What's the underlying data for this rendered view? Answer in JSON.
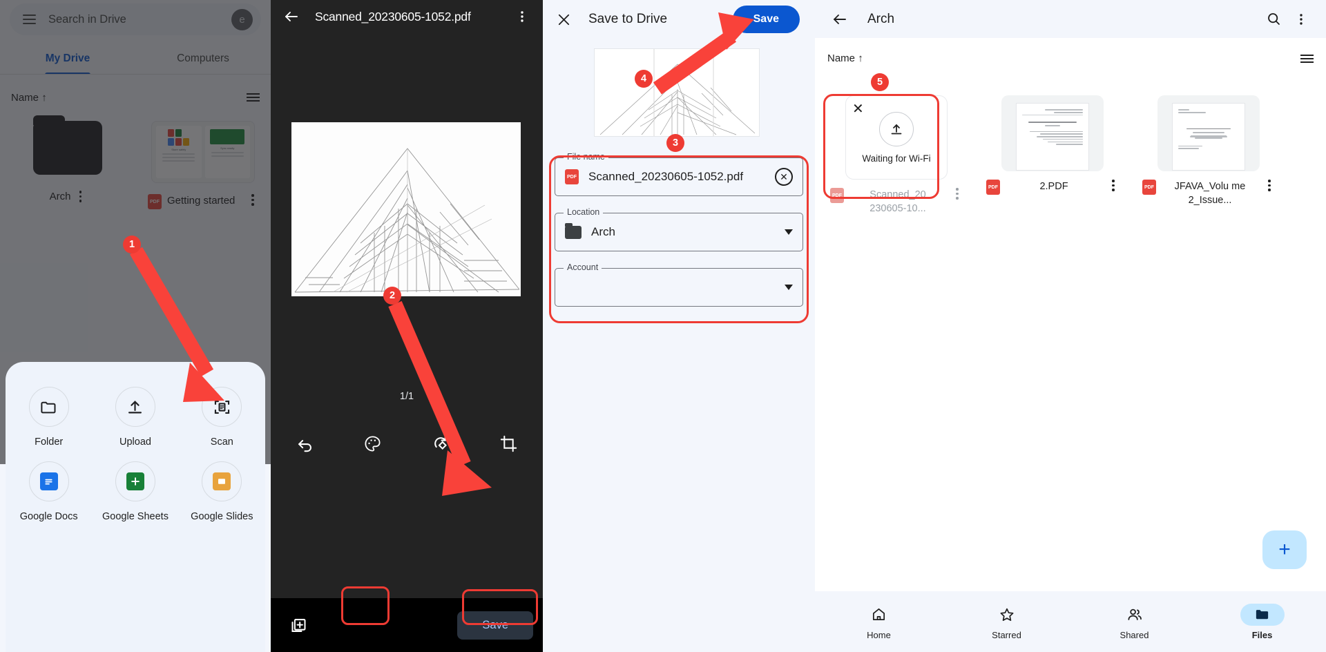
{
  "panel1": {
    "search": {
      "placeholder": "Search in Drive",
      "avatar_initial": "e"
    },
    "tabs": [
      {
        "label": "My Drive",
        "active": true
      },
      {
        "label": "Computers",
        "active": false
      }
    ],
    "sort": {
      "label": "Name",
      "arrow": "↑"
    },
    "items": [
      {
        "name": "Arch",
        "type": "folder"
      },
      {
        "name": "Getting started",
        "type": "pdf"
      }
    ],
    "sheet": {
      "actions": [
        {
          "label": "Folder",
          "icon": "folder-icon"
        },
        {
          "label": "Upload",
          "icon": "upload-icon"
        },
        {
          "label": "Scan",
          "icon": "scan-icon"
        },
        {
          "label": "Google Docs",
          "icon": "google-docs-icon",
          "color": "#1a73e8"
        },
        {
          "label": "Google Sheets",
          "icon": "google-sheets-icon",
          "color": "#188038"
        },
        {
          "label": "Google Slides",
          "icon": "google-slides-icon",
          "color": "#e8a33d"
        }
      ]
    }
  },
  "panel2": {
    "title": "Scanned_20230605-1052.pdf",
    "back_icon": "back-arrow-icon",
    "more_icon": "more-vertical-icon",
    "page_indicator": "1/1",
    "tools": [
      {
        "label": "Undo",
        "icon": "undo-icon"
      },
      {
        "label": "Filter",
        "icon": "palette-icon"
      },
      {
        "label": "Rotate",
        "icon": "rotate-right-icon"
      },
      {
        "label": "Crop",
        "icon": "crop-icon"
      }
    ],
    "add_page_icon": "add-page-icon",
    "save_label": "Save"
  },
  "panel3": {
    "close_icon": "close-icon",
    "title": "Save to Drive",
    "save_label": "Save",
    "fields": [
      {
        "label": "File name",
        "value": "Scanned_20230605-1052.pdf",
        "kind": "text",
        "leading_icon": "pdf-icon",
        "trailing_icon": "clear-icon"
      },
      {
        "label": "Location",
        "value": "Arch",
        "kind": "select",
        "leading_icon": "folder-icon",
        "trailing_icon": "chevron-down-icon"
      },
      {
        "label": "Account",
        "value": "",
        "kind": "select",
        "leading_icon": "",
        "trailing_icon": "chevron-down-icon"
      }
    ]
  },
  "panel4": {
    "back_icon": "back-arrow-icon",
    "title": "Arch",
    "search_icon": "search-icon",
    "more_icon": "more-vertical-icon",
    "sort": {
      "label": "Name",
      "arrow": "↑"
    },
    "view_icon": "list-view-icon",
    "files": [
      {
        "name": "Scanned_20\n230605-10...",
        "status": "Waiting for Wi-Fi",
        "type": "uploading",
        "icon": "pdf-icon"
      },
      {
        "name": "2.PDF",
        "status": "",
        "type": "pdf",
        "icon": "pdf-icon"
      },
      {
        "name": "JFAVA_Volu\nme 2_Issue...",
        "status": "",
        "type": "pdf",
        "icon": "pdf-icon"
      }
    ],
    "fab": {
      "label": "+",
      "icon": "add-icon"
    },
    "nav": [
      {
        "label": "Home",
        "icon": "home-icon",
        "active": false
      },
      {
        "label": "Starred",
        "icon": "star-icon",
        "active": false
      },
      {
        "label": "Shared",
        "icon": "people-icon",
        "active": false
      },
      {
        "label": "Files",
        "icon": "folder-icon",
        "active": true
      }
    ]
  },
  "annotations": {
    "accent_color": "#ee3b33",
    "steps": [
      {
        "number": "1",
        "target": "scan-action-button"
      },
      {
        "number": "2",
        "target": "scan-save-button"
      },
      {
        "number": "3",
        "target": "save-to-drive-form"
      },
      {
        "number": "4",
        "target": "save-to-drive-save-button"
      },
      {
        "number": "5",
        "target": "uploading-file-card"
      }
    ]
  }
}
